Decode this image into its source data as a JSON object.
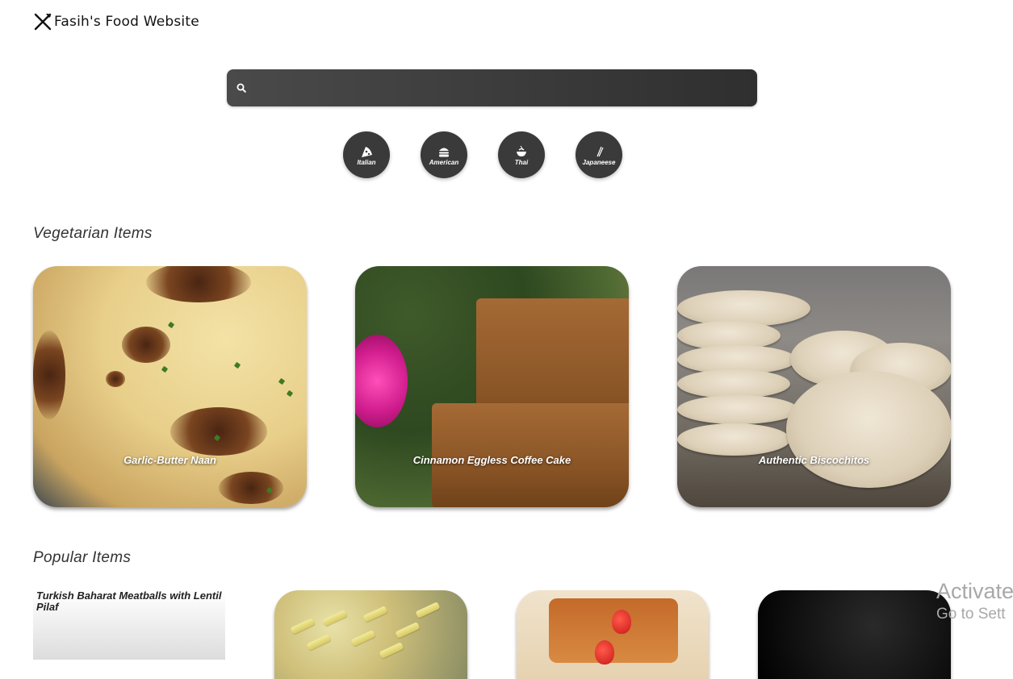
{
  "header": {
    "title": "Fasih's Food Website",
    "logo_icon": "fork-knife-icon"
  },
  "search": {
    "placeholder": "",
    "value": ""
  },
  "cuisines": [
    {
      "label": "Italian",
      "icon": "pizza-icon"
    },
    {
      "label": "American",
      "icon": "burger-icon"
    },
    {
      "label": "Thai",
      "icon": "noodle-bowl-icon"
    },
    {
      "label": "Japaneese",
      "icon": "chopsticks-icon"
    }
  ],
  "sections": {
    "vegetarian": {
      "title": "Vegetarian Items",
      "items": [
        {
          "name": "Garlic-Butter Naan"
        },
        {
          "name": "Cinnamon Eggless Coffee Cake"
        },
        {
          "name": "Authentic Biscochitos"
        }
      ]
    },
    "popular": {
      "title": "Popular Items",
      "items": [
        {
          "name": "Turkish Baharat Meatballs with Lentil Pilaf"
        },
        {
          "name": ""
        },
        {
          "name": ""
        },
        {
          "name": ""
        }
      ]
    }
  },
  "windows_watermark": {
    "line1": "Activate",
    "line2": "Go to Sett"
  },
  "colors": {
    "accent": "#3a3a3a",
    "search_bar": "#404040",
    "background": "#ffffff"
  }
}
